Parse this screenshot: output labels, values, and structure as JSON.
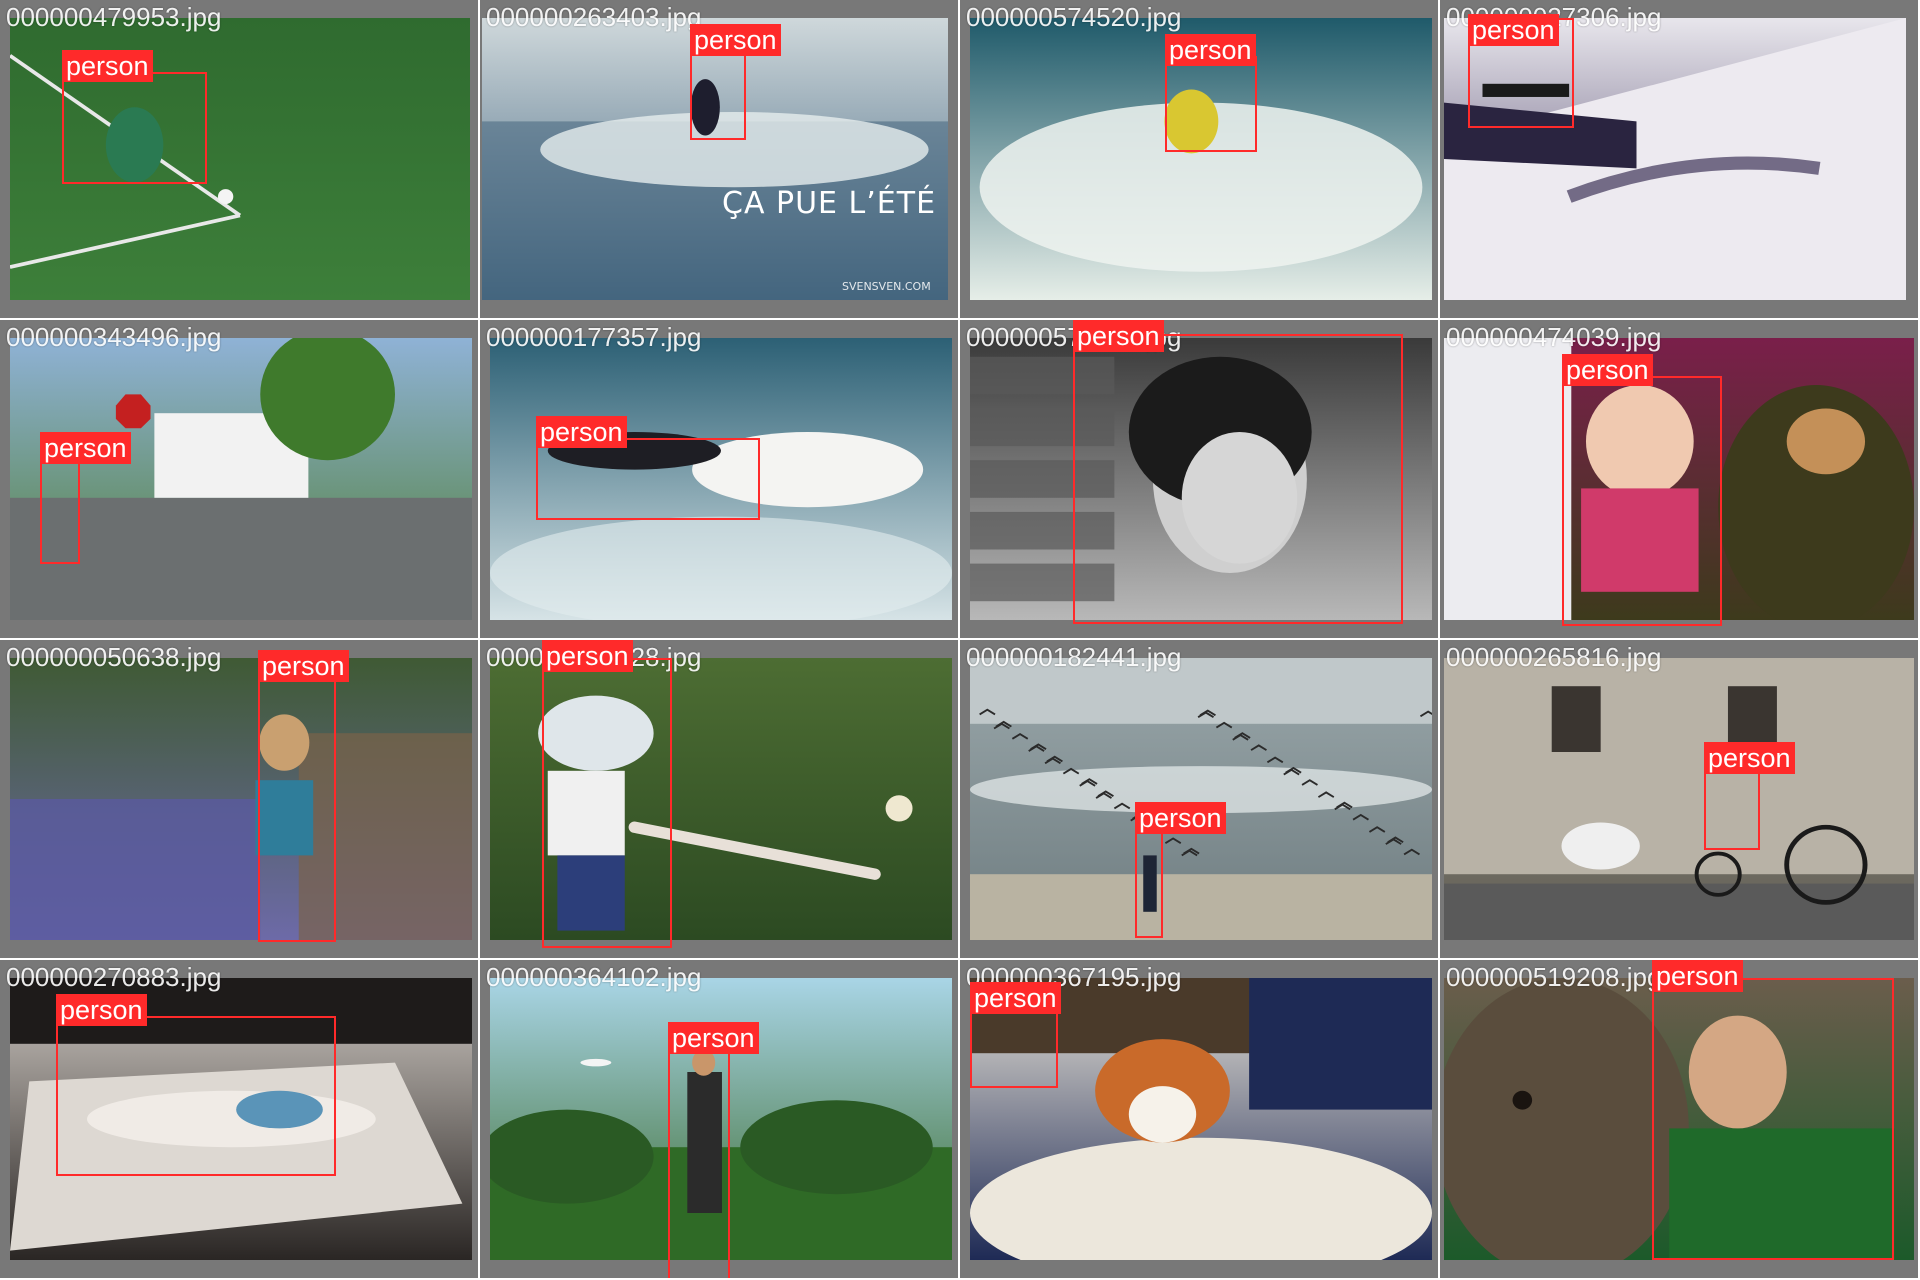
{
  "tiles": [
    {
      "file": "000000479953.jpg",
      "label": "person",
      "scene": "soccer-field",
      "colors": [
        "#2f6b2f",
        "#3d7f3a"
      ]
    },
    {
      "file": "000000263403.jpg",
      "label": "person",
      "scene": "surf-wave-poster",
      "colors": [
        "#cfd8db",
        "#3a5e7a"
      ],
      "overlay_text": "ÇA PUE L’ÉTÉ",
      "watermark": "SVENSVEN.COM"
    },
    {
      "file": "000000574520.jpg",
      "label": "person",
      "scene": "surf-splash",
      "colors": [
        "#1f5a6a",
        "#e6eee8"
      ]
    },
    {
      "file": "000000027306.jpg",
      "label": "person",
      "scene": "skateboard-ledge",
      "colors": [
        "#e8e6ec",
        "#453a63"
      ]
    },
    {
      "file": "000000343496.jpg",
      "label": "person",
      "scene": "street-stop-sign",
      "colors": [
        "#8fb2d6",
        "#4f7e34"
      ]
    },
    {
      "file": "000000177357.jpg",
      "label": "person",
      "scene": "surfer-board",
      "colors": [
        "#2c6075",
        "#d6e3e6"
      ]
    },
    {
      "file": "000000579655.jpg",
      "label": "person",
      "scene": "bw-phone-portrait",
      "colors": [
        "#3a3a3a",
        "#b8b8b8"
      ]
    },
    {
      "file": "000000474039.jpg",
      "label": "person",
      "scene": "baby-teddy-bear",
      "colors": [
        "#7a1f4a",
        "#3d3a1c"
      ]
    },
    {
      "file": "000000050638.jpg",
      "label": "person",
      "scene": "child-bluebells",
      "colors": [
        "#3f5a34",
        "#6d6aa8"
      ]
    },
    {
      "file": "000000297928.jpg",
      "label": "person",
      "scene": "kid-baseball-bat",
      "colors": [
        "#4d6d33",
        "#2c4a22"
      ]
    },
    {
      "file": "000000182441.jpg",
      "label": "person",
      "scene": "beach-birds",
      "colors": [
        "#9aa7aa",
        "#6e7c80"
      ]
    },
    {
      "file": "000000265816.jpg",
      "label": "person",
      "scene": "horse-carriage",
      "colors": [
        "#a19a8d",
        "#5d5b52"
      ]
    },
    {
      "file": "000000270883.jpg",
      "label": "person",
      "scene": "woman-on-bed",
      "colors": [
        "#cfc9c3",
        "#2a2624"
      ]
    },
    {
      "file": "000000364102.jpg",
      "label": "person",
      "scene": "frisbee-park",
      "colors": [
        "#a9d5e6",
        "#3a6a2d"
      ]
    },
    {
      "file": "000000367195.jpg",
      "label": "person",
      "scene": "corgi-rug",
      "colors": [
        "#e9e4d8",
        "#1e2a55"
      ]
    },
    {
      "file": "000000519208.jpg",
      "label": "person",
      "scene": "elephant-man",
      "colors": [
        "#6b5d4c",
        "#1c5a2a"
      ]
    }
  ],
  "box_color": "#ff2a2a"
}
